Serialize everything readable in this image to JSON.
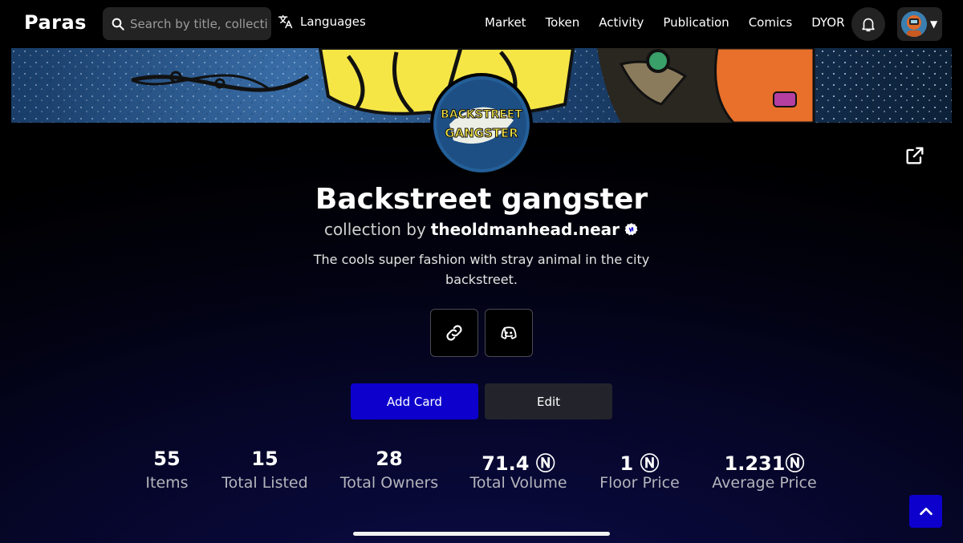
{
  "nav": {
    "logo": "Paras",
    "search_placeholder": "Search by title, collection",
    "languages_label": "Languages",
    "links": [
      "Market",
      "Token",
      "Activity",
      "Publication",
      "Comics",
      "DYOR"
    ]
  },
  "collection": {
    "logo_line1": "BACKSTREET",
    "logo_line2": "GANGSTER",
    "title": "Backstreet gangster",
    "byline_prefix": "collection by",
    "creator": "theoldmanhead.near",
    "description": "The cools super fashion with stray animal in the city backstreet."
  },
  "actions": {
    "add_card": "Add Card",
    "edit": "Edit"
  },
  "stats": [
    {
      "value": "55",
      "label": "Items"
    },
    {
      "value": "15",
      "label": "Total Listed"
    },
    {
      "value": "28",
      "label": "Total Owners"
    },
    {
      "value": "71.4 Ⓝ",
      "label": "Total Volume"
    },
    {
      "value": "1 Ⓝ",
      "label": "Floor Price"
    },
    {
      "value": "1.231Ⓝ",
      "label": "Average Price"
    }
  ],
  "icons": {
    "search": "search-icon",
    "languages": "translate-icon",
    "notifications": "bell-icon",
    "share": "external-link-icon",
    "website": "link-icon",
    "discord": "discord-icon",
    "scroll_top": "chevron-up-icon",
    "verified": "verified-badge-icon"
  },
  "colors": {
    "primary": "#0d00cc",
    "secondary": "#23242b",
    "navbar": "#000000"
  }
}
